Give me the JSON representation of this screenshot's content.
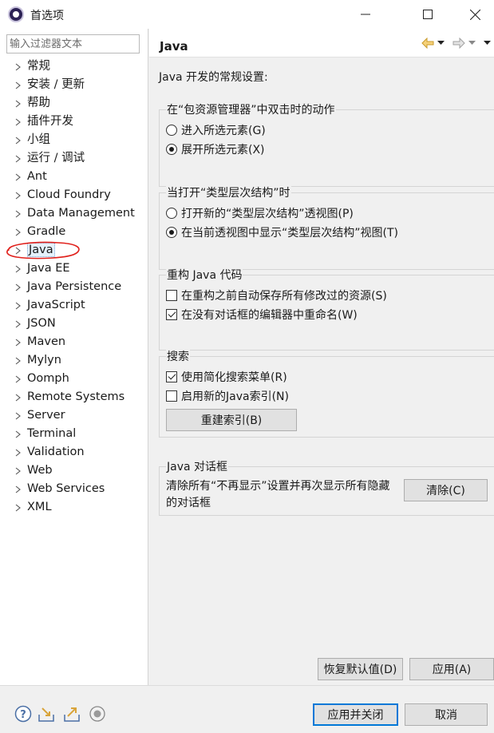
{
  "window": {
    "title": "首选项"
  },
  "filter": {
    "placeholder": "输入过滤器文本"
  },
  "tree": {
    "items": [
      {
        "label": "常规"
      },
      {
        "label": "安装 / 更新"
      },
      {
        "label": "帮助"
      },
      {
        "label": "插件开发"
      },
      {
        "label": "小组"
      },
      {
        "label": "运行 / 调试"
      },
      {
        "label": "Ant"
      },
      {
        "label": "Cloud Foundry"
      },
      {
        "label": "Data Management"
      },
      {
        "label": "Gradle"
      },
      {
        "label": "Java"
      },
      {
        "label": "Java EE"
      },
      {
        "label": "Java Persistence"
      },
      {
        "label": "JavaScript"
      },
      {
        "label": "JSON"
      },
      {
        "label": "Maven"
      },
      {
        "label": "Mylyn"
      },
      {
        "label": "Oomph"
      },
      {
        "label": "Remote Systems"
      },
      {
        "label": "Server"
      },
      {
        "label": "Terminal"
      },
      {
        "label": "Validation"
      },
      {
        "label": "Web"
      },
      {
        "label": "Web Services"
      },
      {
        "label": "XML"
      }
    ]
  },
  "page": {
    "title": "Java",
    "intro": "Java 开发的常规设置:"
  },
  "group_dblclick": {
    "title": "在“包资源管理器”中双击时的动作",
    "opt_goto": "进入所选元素(G)",
    "opt_expand": "展开所选元素(X)"
  },
  "group_hierarchy": {
    "title": "当打开“类型层次结构”时",
    "opt_new_perspective": "打开新的“类型层次结构”透视图(P)",
    "opt_current_view": "在当前透视图中显示“类型层次结构”视图(T)"
  },
  "group_refactor": {
    "title": "重构 Java 代码",
    "opt_autosave": "在重构之前自动保存所有修改过的资源(S)",
    "opt_rename_inline": "在没有对话框的编辑器中重命名(W)"
  },
  "group_search": {
    "title": "搜索",
    "opt_simple_menu": "使用简化搜索菜单(R)",
    "opt_new_index": "启用新的Java索引(N)",
    "rebuild_button": "重建索引(B)"
  },
  "group_dialogs": {
    "title": "Java 对话框",
    "description": "清除所有“不再显示”设置并再次显示所有隐藏的对话框",
    "clear_button": "清除(C)"
  },
  "buttons": {
    "restore_defaults": "恢复默认值(D)",
    "apply": "应用(A)",
    "apply_and_close": "应用并关闭",
    "cancel": "取消"
  },
  "state": {
    "dblclick_selected": "expand",
    "hierarchy_selected": "current_view",
    "refactor_autosave": false,
    "refactor_rename_inline": true,
    "search_simple_menu": true,
    "search_new_index": false,
    "selected_tree_item": "Java"
  },
  "colors": {
    "annotation_circle": "#e0201b",
    "primary_button_border": "#0078d7",
    "selection_bg": "#e5f1fb"
  },
  "icons": {
    "back": "back-arrow-icon",
    "forward": "forward-arrow-icon",
    "menu": "view-menu-icon",
    "help": "help-icon",
    "import": "import-icon",
    "export": "export-icon",
    "record": "oomph-record-icon"
  }
}
